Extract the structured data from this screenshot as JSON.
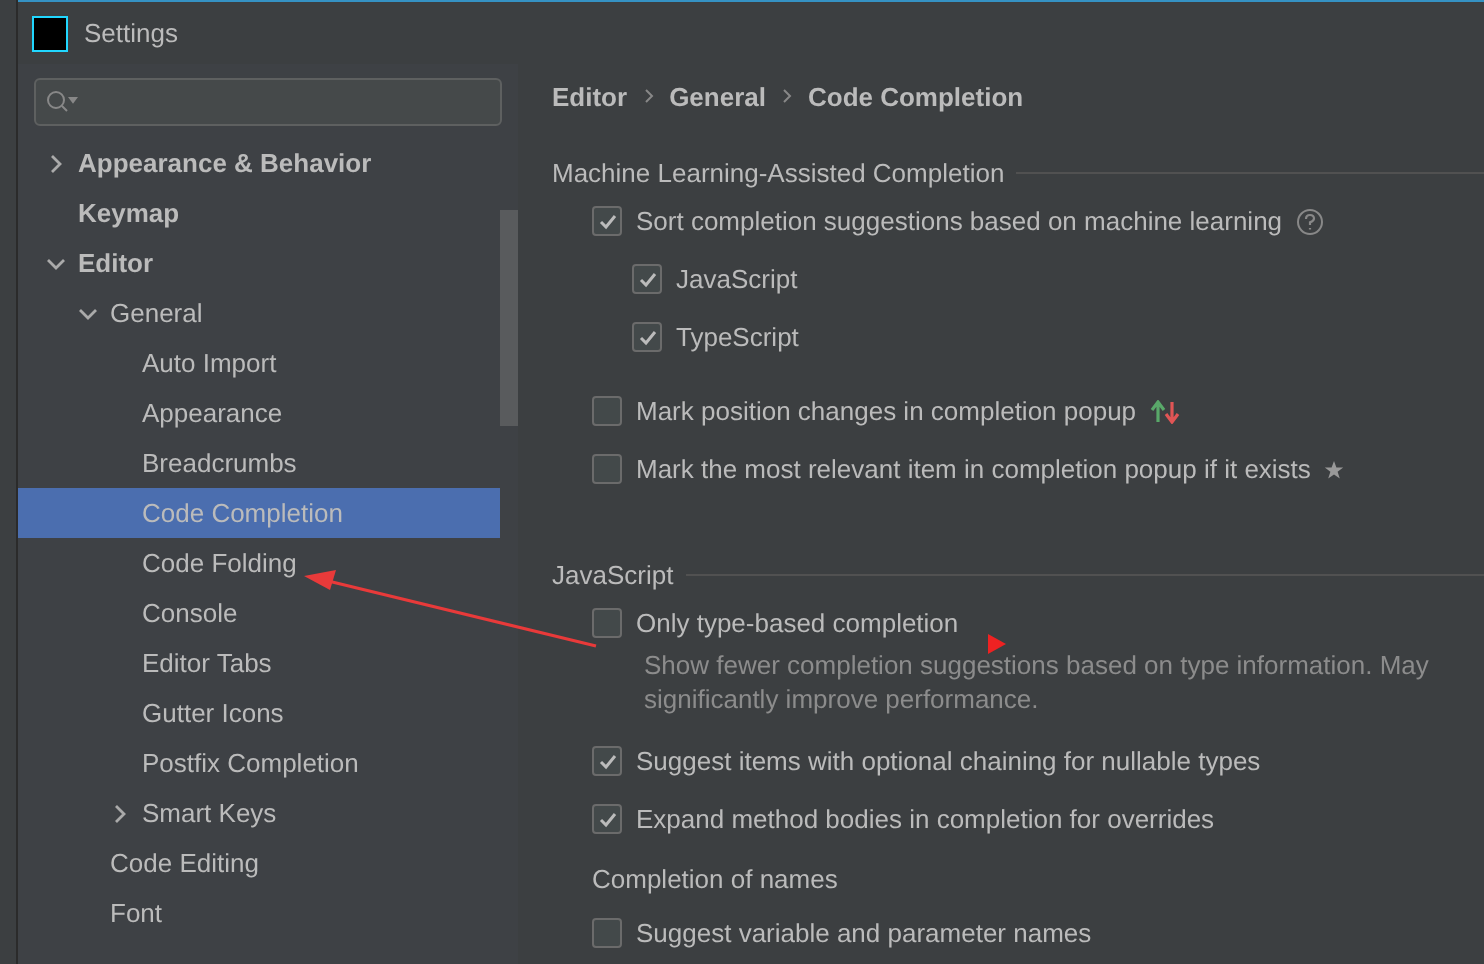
{
  "window": {
    "title": "Settings"
  },
  "sidebar": {
    "items": [
      {
        "label": "Appearance & Behavior",
        "expanded": false,
        "selected": false
      },
      {
        "label": "Keymap",
        "selected": false
      },
      {
        "label": "Editor",
        "expanded": true,
        "selected": false,
        "children": [
          {
            "label": "General",
            "expanded": true,
            "selected": false,
            "children": [
              {
                "label": "Auto Import",
                "selected": false
              },
              {
                "label": "Appearance",
                "selected": false
              },
              {
                "label": "Breadcrumbs",
                "selected": false
              },
              {
                "label": "Code Completion",
                "selected": true
              },
              {
                "label": "Code Folding",
                "selected": false
              },
              {
                "label": "Console",
                "selected": false
              },
              {
                "label": "Editor Tabs",
                "selected": false
              },
              {
                "label": "Gutter Icons",
                "selected": false
              },
              {
                "label": "Postfix Completion",
                "selected": false
              },
              {
                "label": "Smart Keys",
                "expanded": false,
                "selected": false
              }
            ]
          },
          {
            "label": "Code Editing",
            "selected": false
          },
          {
            "label": "Font",
            "selected": false
          }
        ]
      }
    ]
  },
  "breadcrumb": [
    "Editor",
    "General",
    "Code Completion"
  ],
  "content": [
    {
      "kind": "section",
      "label": "Machine Learning-Assisted Completion"
    },
    {
      "kind": "checkbox",
      "label": "Sort completion suggestions based on machine learning",
      "checked": true,
      "icon": {
        "kind": "help"
      },
      "children": [
        {
          "kind": "checkbox",
          "label": "JavaScript",
          "checked": true
        },
        {
          "kind": "checkbox",
          "label": "TypeScript",
          "checked": true
        }
      ]
    },
    {
      "kind": "checkbox",
      "label": "Mark position changes in completion popup",
      "checked": false,
      "icon": {
        "kind": "arrows"
      }
    },
    {
      "kind": "checkbox",
      "label": "Mark the most relevant item in completion popup if it exists",
      "checked": false,
      "icon": {
        "kind": "star"
      }
    },
    {
      "kind": "section",
      "label": "JavaScript"
    },
    {
      "kind": "checkbox",
      "label": "Only type-based completion",
      "checked": false,
      "description": "Show fewer completion suggestions based on type information. May significantly improve performance."
    },
    {
      "kind": "checkbox",
      "label": "Suggest items with optional chaining for nullable types",
      "checked": true
    },
    {
      "kind": "checkbox",
      "label": "Expand method bodies in completion for overrides",
      "checked": true
    },
    {
      "kind": "subheading",
      "label": "Completion of names"
    },
    {
      "kind": "checkbox",
      "label": "Suggest variable and parameter names",
      "checked": false
    }
  ]
}
